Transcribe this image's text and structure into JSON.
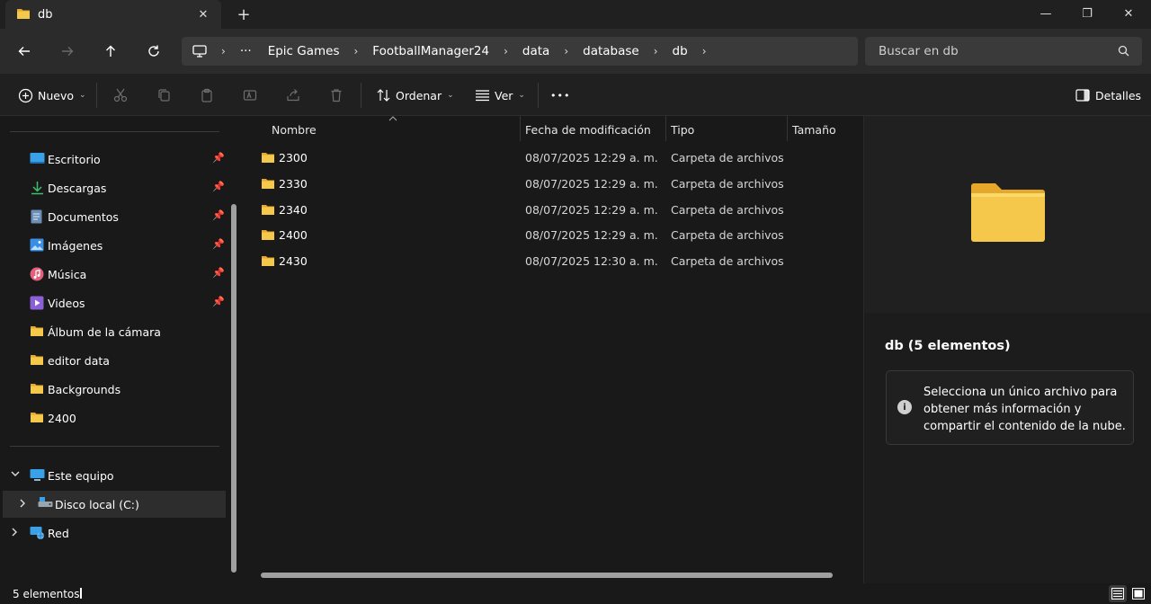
{
  "window": {
    "tab_title": "db",
    "tab_close": "✕",
    "new_tab": "+",
    "minimize": "—",
    "maximize": "❐",
    "close": "✕"
  },
  "address": {
    "more": "···",
    "crumbs": [
      "Epic Games",
      "FootballManager24",
      "data",
      "database",
      "db"
    ],
    "separator": "›",
    "search_placeholder": "Buscar en db"
  },
  "toolbar": {
    "new_label": "Nuevo",
    "sort_label": "Ordenar",
    "view_label": "Ver",
    "more_label": "•••",
    "details_label": "Detalles"
  },
  "sidebar": {
    "quick_access": [
      {
        "label": "Escritorio",
        "icon": "desktop-icon",
        "pinned": true
      },
      {
        "label": "Descargas",
        "icon": "download-icon",
        "pinned": true
      },
      {
        "label": "Documentos",
        "icon": "document-icon",
        "pinned": true
      },
      {
        "label": "Imágenes",
        "icon": "pictures-icon",
        "pinned": true
      },
      {
        "label": "Música",
        "icon": "music-icon",
        "pinned": true
      },
      {
        "label": "Videos",
        "icon": "video-icon",
        "pinned": true
      },
      {
        "label": "Álbum de la cámara",
        "icon": "folder-icon",
        "pinned": false
      },
      {
        "label": "editor data",
        "icon": "folder-icon",
        "pinned": false
      },
      {
        "label": "Backgrounds",
        "icon": "folder-icon",
        "pinned": false
      },
      {
        "label": "2400",
        "icon": "folder-icon",
        "pinned": false
      }
    ],
    "this_pc": "Este equipo",
    "local_disk": "Disco local (C:)",
    "network": "Red"
  },
  "filelist": {
    "columns": {
      "name": "Nombre",
      "modified": "Fecha de modificación",
      "type": "Tipo",
      "size": "Tamaño"
    },
    "rows": [
      {
        "name": "2300",
        "modified": "08/07/2025 12:29 a. m.",
        "type": "Carpeta de archivos"
      },
      {
        "name": "2330",
        "modified": "08/07/2025 12:29 a. m.",
        "type": "Carpeta de archivos"
      },
      {
        "name": "2340",
        "modified": "08/07/2025 12:29 a. m.",
        "type": "Carpeta de archivos"
      },
      {
        "name": "2400",
        "modified": "08/07/2025 12:29 a. m.",
        "type": "Carpeta de archivos"
      },
      {
        "name": "2430",
        "modified": "08/07/2025 12:30 a. m.",
        "type": "Carpeta de archivos"
      }
    ]
  },
  "details": {
    "title": "db (5 elementos)",
    "info_icon": "i",
    "info_text": "Selecciona un único archivo para obtener más información y compartir el contenido de la nube."
  },
  "status": {
    "count": "5 elementos"
  },
  "colors": {
    "folder": "#f5c84c",
    "folder_dark": "#e6a82a",
    "background": "#191919"
  }
}
